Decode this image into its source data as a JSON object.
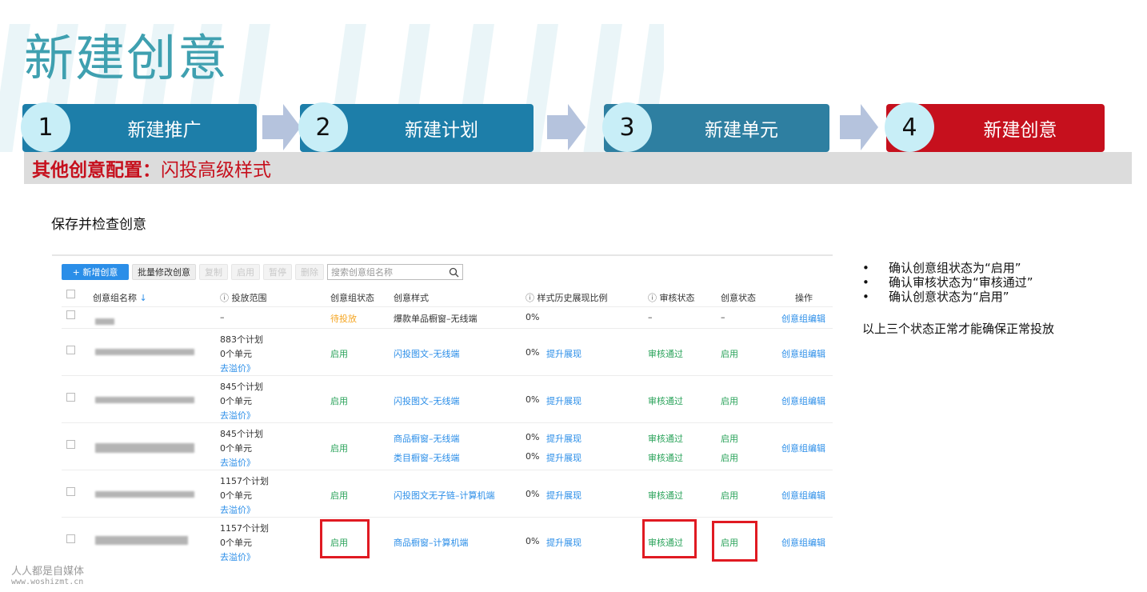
{
  "title": "新建创意",
  "steps": [
    {
      "num": "1",
      "label": "新建推广"
    },
    {
      "num": "2",
      "label": "新建计划"
    },
    {
      "num": "3",
      "label": "新建单元"
    },
    {
      "num": "4",
      "label": "新建创意"
    }
  ],
  "subtitle": {
    "bold": "其他创意配置：",
    "rest": "闪投高级样式"
  },
  "save_text": "保存并检查创意",
  "toolbar": {
    "new_label": "+ 新增创意",
    "batch_label": "批量修改创意",
    "copy_label": "复制",
    "enable_label": "启用",
    "pause_label": "暂停",
    "delete_label": "删除",
    "search_placeholder": "搜索创意组名称"
  },
  "table": {
    "headers": {
      "name": "创意组名称",
      "range": "投放范围",
      "group_status": "创意组状态",
      "style": "创意样式",
      "ratio": "样式历史展现比例",
      "audit": "审核状态",
      "creative_status": "创意状态",
      "op": "操作"
    },
    "rows": [
      {
        "range": [
          "–"
        ],
        "group_status": "待投放",
        "styles": [
          {
            "name": "爆款单品橱窗–无线端",
            "ratio": "0%",
            "boost": "",
            "audit": "–",
            "status": "–"
          }
        ],
        "op": "创意组编辑"
      },
      {
        "range": [
          "883个计划",
          "0个单元",
          "去溢价》"
        ],
        "group_status": "启用",
        "styles": [
          {
            "name": "闪投图文–无线端",
            "ratio": "0%",
            "boost": "提升展现",
            "audit": "审核通过",
            "status": "启用"
          }
        ],
        "op": "创意组编辑"
      },
      {
        "range": [
          "845个计划",
          "0个单元",
          "去溢价》"
        ],
        "group_status": "启用",
        "styles": [
          {
            "name": "闪投图文–无线端",
            "ratio": "0%",
            "boost": "提升展现",
            "audit": "审核通过",
            "status": "启用"
          }
        ],
        "op": "创意组编辑"
      },
      {
        "range": [
          "845个计划",
          "0个单元",
          "去溢价》"
        ],
        "group_status": "启用",
        "styles": [
          {
            "name": "商品橱窗–无线端",
            "ratio": "0%",
            "boost": "提升展现",
            "audit": "审核通过",
            "status": "启用"
          },
          {
            "name": "类目橱窗–无线端",
            "ratio": "0%",
            "boost": "提升展现",
            "audit": "审核通过",
            "status": "启用"
          }
        ],
        "op": "创意组编辑"
      },
      {
        "range": [
          "1157个计划",
          "0个单元",
          "去溢价》"
        ],
        "group_status": "启用",
        "styles": [
          {
            "name": "闪投图文无子链–计算机端",
            "ratio": "0%",
            "boost": "提升展现",
            "audit": "审核通过",
            "status": "启用"
          }
        ],
        "op": "创意组编辑"
      },
      {
        "range": [
          "1157个计划",
          "0个单元",
          "去溢价》"
        ],
        "group_status": "启用",
        "styles": [
          {
            "name": "商品橱窗–计算机端",
            "ratio": "0%",
            "boost": "提升展现",
            "audit": "审核通过",
            "status": "启用"
          }
        ],
        "op": "创意组编辑"
      }
    ]
  },
  "notes": [
    "确认创意组状态为“启用”",
    "确认审核状态为“审核通过”",
    "确认创意状态为“启用”"
  ],
  "conclusion": "以上三个状态正常才能确保正常投放",
  "watermark": {
    "line1": "人人都是自媒体",
    "line2": "www.woshizmt.cn"
  },
  "colors": {
    "accent_red": "#c6101d",
    "step_blue": "#1d7ea9",
    "link_blue": "#2b8ee8",
    "ok_green": "#2aa35a",
    "pending_orange": "#f5a623",
    "title_teal": "#3fa0b0"
  }
}
